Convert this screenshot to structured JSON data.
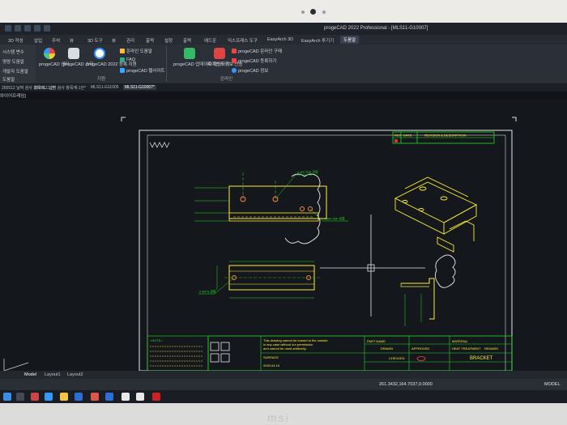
{
  "window": {
    "title": "progeCAD 2022 Professional - [MLS11-G10007]"
  },
  "ribbon_tabs": [
    "2D 작성",
    "삽입",
    "주석",
    "뷰",
    "3D 도구",
    "뷰",
    "관리",
    "출력",
    "설정",
    "출력",
    "애드온",
    "익스프레스 도구",
    "EasyArch 3D",
    "EasyArch 투기기",
    "도움말"
  ],
  "ribbon": {
    "left_items": [
      "시스템 변수",
      "명령 도움말",
      "개발자 도움말",
      "도움말"
    ],
    "buttons": [
      {
        "label": "progeCAD 센터"
      },
      {
        "label": "progeCAD 스타"
      },
      {
        "label": "progeCAD 2022 등록 지원"
      }
    ],
    "help_items": [
      "온라인 도움말",
      "FAQ",
      "progeCAD 웹사이트"
    ],
    "help_group": "지원",
    "update_button": "progeCAD 업데이트 확인하기",
    "license_button": "라이선스 정보 전송",
    "online_items": [
      "progeCAD 온라인 구매",
      "progeCAD 등록하기",
      "progeCAD 정보"
    ],
    "online_group": "온라인"
  },
  "doc_tabs": [
    "250512 날짜 검사 항목계...1안*",
    "250512 납땜 검사 항목계-1안*",
    "MLS11-G11005",
    "MLS11-G10007*"
  ],
  "view_label": "와이어프레임]",
  "drawing": {
    "revision_header": [
      "REV",
      "DATE",
      "REVISION & DESCRIPTION"
    ],
    "title_block": {
      "notice": [
        "This drawing cannot be loaned to the outside",
        "in any case without our permission",
        "and cannot be used arbitrarily."
      ],
      "part_label": "PART NAME",
      "part_name": "BRACKET",
      "surface": "SURFACE",
      "date": "2020.04.10",
      "labels": [
        "DRAWN",
        "CHECKED",
        "APPROVED",
        "MATERIAL",
        "HEAT TREATMENT",
        "REMARK"
      ]
    },
    "notes": [
      "<NOTE>"
    ],
    "annotations": [
      "2-Ø3 TAP 관통",
      "4-Ø4 TAP 관통",
      "2-Ø4.5 관통"
    ]
  },
  "layout_tabs": [
    "Model",
    "Layout1",
    "Layout2"
  ],
  "status": {
    "coords": "261.3432,164.7037,0.0000",
    "mode": "MODEL"
  },
  "brand": "msi"
}
